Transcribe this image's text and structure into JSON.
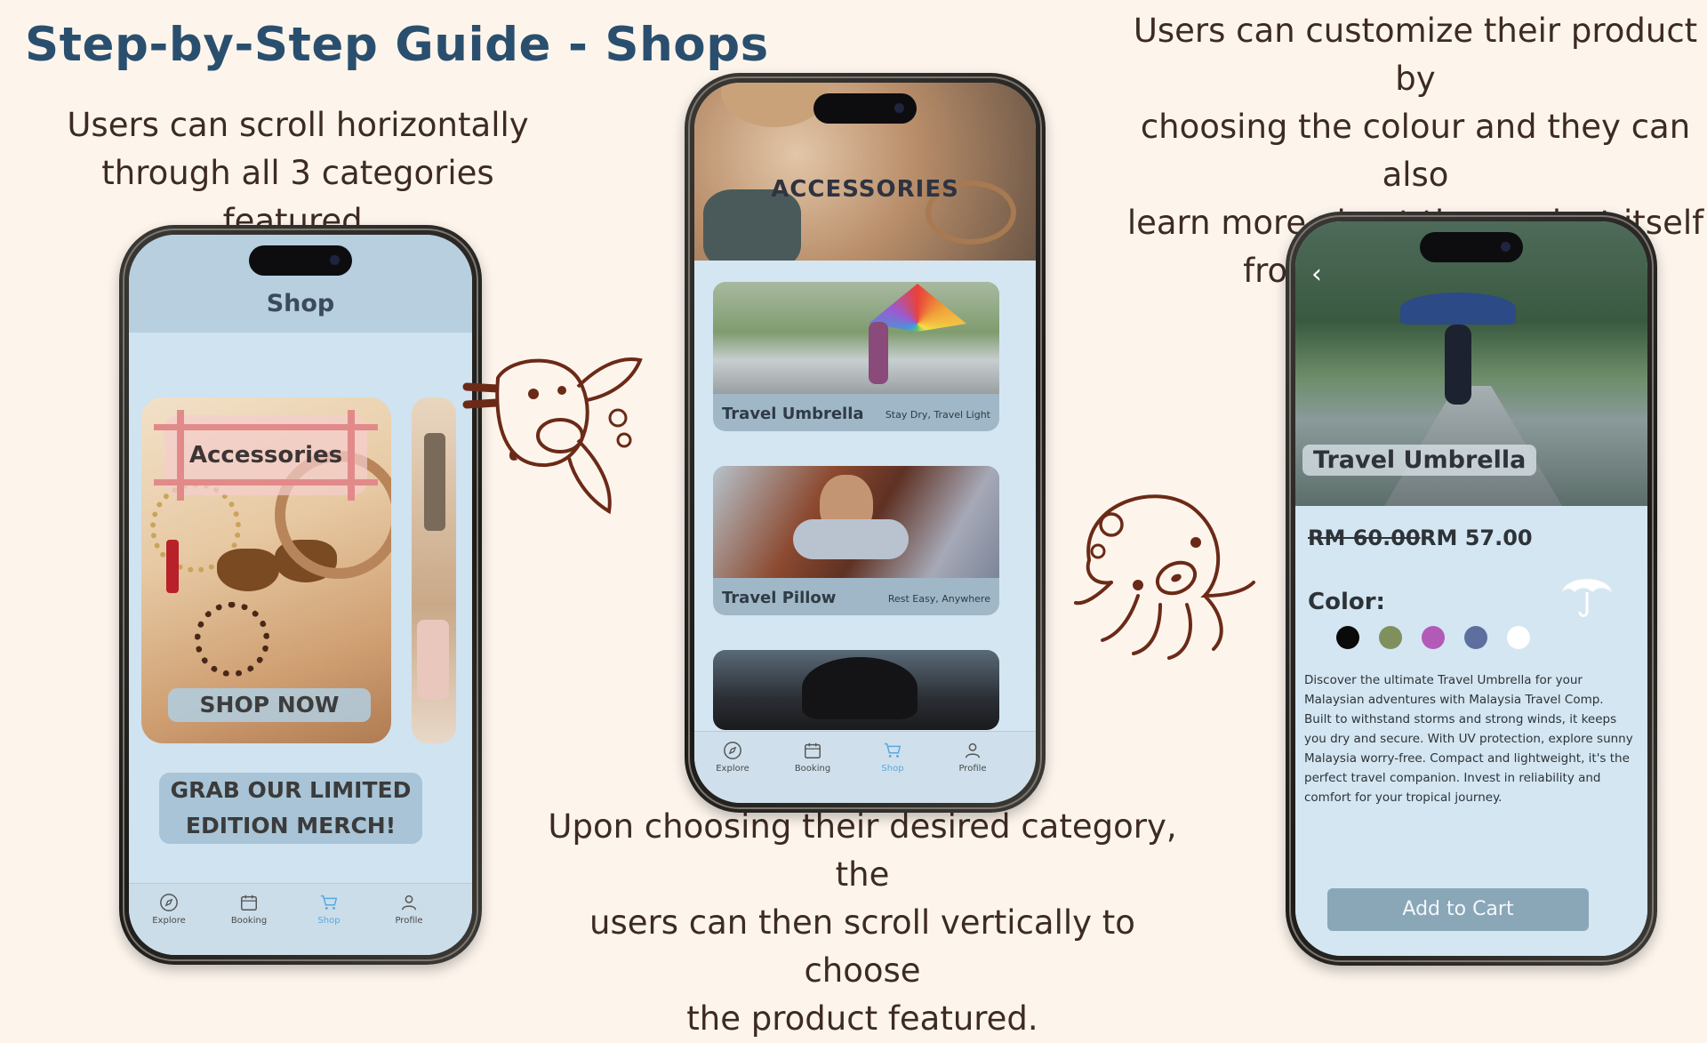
{
  "page": {
    "title": "Step-by-Step Guide - Shops",
    "caption_left": [
      "Users can scroll horizontally",
      "through all 3 categories featured."
    ],
    "caption_right": [
      "Users can customize their product by",
      "choosing the colour and they can also",
      "learn more about the product itself",
      "from the description."
    ],
    "caption_bottom": [
      "Upon choosing their desired category, the",
      "users can then scroll vertically to choose",
      "the product featured."
    ]
  },
  "phone1": {
    "header_title": "Shop",
    "card_label": "Accessories",
    "card_button": "SHOP NOW",
    "merch_line1": "GRAB OUR LIMITED",
    "merch_line2": "EDITION MERCH!",
    "tabs": [
      {
        "label": "Explore",
        "icon": "compass-icon"
      },
      {
        "label": "Booking",
        "icon": "calendar-icon"
      },
      {
        "label": "Shop",
        "icon": "cart-icon",
        "active": true
      },
      {
        "label": "Profile",
        "icon": "user-icon"
      }
    ]
  },
  "phone2": {
    "hero_title": "ACCESSORIES",
    "products": [
      {
        "name": "Travel Umbrella",
        "tagline": "Stay Dry, Travel Light"
      },
      {
        "name": "Travel Pillow",
        "tagline": "Rest Easy, Anywhere"
      }
    ],
    "tabs": [
      {
        "label": "Explore",
        "icon": "compass-icon"
      },
      {
        "label": "Booking",
        "icon": "calendar-icon"
      },
      {
        "label": "Shop",
        "icon": "cart-icon",
        "active": true
      },
      {
        "label": "Profile",
        "icon": "user-icon"
      }
    ]
  },
  "phone3": {
    "product_name": "Travel Umbrella",
    "old_price": "RM 60.00",
    "new_price": "RM 57.00",
    "color_label": "Color:",
    "swatches": [
      "#0a0a0a",
      "#7f8f5e",
      "#b35ab8",
      "#5d6f9f",
      "#ffffff"
    ],
    "description": "Discover the ultimate Travel Umbrella for your Malaysian adventures with Malaysia Travel Comp. Built to withstand storms and strong winds, it keeps you dry and secure. With UV protection, explore sunny Malaysia worry-free. Compact and lightweight, it's the perfect travel companion. Invest in reliability and comfort for your tropical journey.",
    "cart_button": "Add to Cart"
  },
  "colors": {
    "title": "#2a4f6e",
    "background": "#fdf5ec",
    "screen_bg": "#d3e6f2",
    "active_tab": "#55a9e0",
    "doodle": "#6b2a17"
  }
}
